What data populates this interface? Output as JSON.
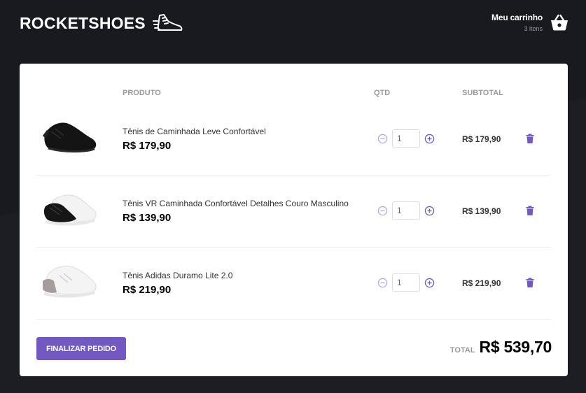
{
  "header": {
    "logo_text": "ROCKETSHOES",
    "logo_icon": "running-shoe-icon",
    "cart_title": "Meu carrinho",
    "cart_count": "3 itens",
    "cart_icon": "basket-icon"
  },
  "table": {
    "col_product": "PRODUTO",
    "col_qty": "QTD",
    "col_subtotal": "SUBTOTAL",
    "items": [
      {
        "title": "Tênis de Caminhada Leve Confortável",
        "price": "R$ 179,90",
        "qty": "1",
        "subtotal": "R$ 179,90"
      },
      {
        "title": "Tênis VR Caminhada Confortável Detalhes Couro Masculino",
        "price": "R$ 139,90",
        "qty": "1",
        "subtotal": "R$ 139,90"
      },
      {
        "title": "Tênis Adidas Duramo Lite 2.0",
        "price": "R$ 219,90",
        "qty": "1",
        "subtotal": "R$ 219,90"
      }
    ]
  },
  "footer": {
    "finish_label": "FINALIZAR PEDIDO",
    "total_label": "TOTAL",
    "total_value": "R$ 539,70"
  },
  "colors": {
    "accent": "#7159c1",
    "background": "#191920"
  }
}
